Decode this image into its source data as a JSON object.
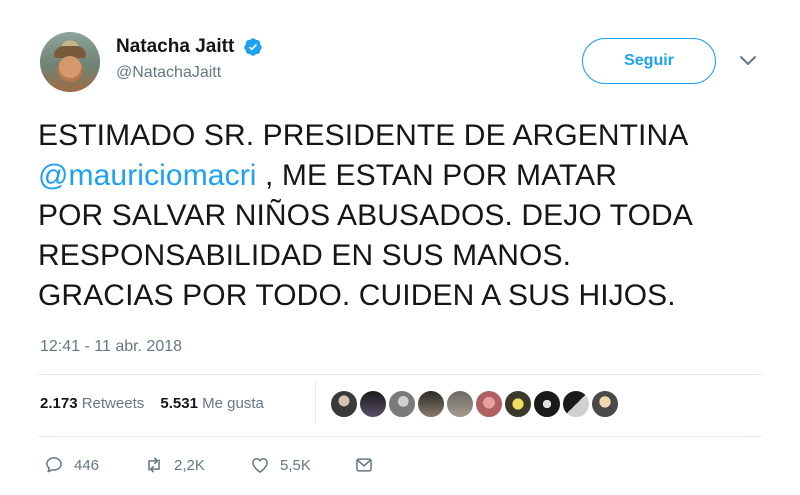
{
  "user": {
    "display_name": "Natacha Jaitt",
    "handle": "@NatachaJaitt",
    "verified": true,
    "follow_label": "Seguir"
  },
  "tweet": {
    "lines": [
      {
        "text": "ESTIMADO SR. PRESIDENTE DE ARGENTINA"
      },
      {
        "mention": "@mauriciomacri",
        "text": " , ME ESTAN POR MATAR"
      },
      {
        "text": "POR SALVAR NIÑOS ABUSADOS. DEJO TODA"
      },
      {
        "text": "RESPONSABILIDAD EN SUS MANOS."
      },
      {
        "text": "GRACIAS POR TODO. CUIDEN A SUS HIJOS."
      }
    ],
    "timestamp": "12:41 - 11 abr. 2018"
  },
  "stats": {
    "retweets_count": "2.173",
    "retweets_label": "Retweets",
    "likes_count": "5.531",
    "likes_label": "Me gusta"
  },
  "actions": {
    "reply_count": "446",
    "retweet_count": "2,2K",
    "like_count": "5,5K"
  },
  "colors": {
    "accent": "#1da1f2",
    "muted": "#657786",
    "text": "#14171a"
  },
  "icons": [
    "verified-badge-icon",
    "chevron-down-icon",
    "reply-icon",
    "retweet-icon",
    "heart-icon",
    "message-icon"
  ]
}
